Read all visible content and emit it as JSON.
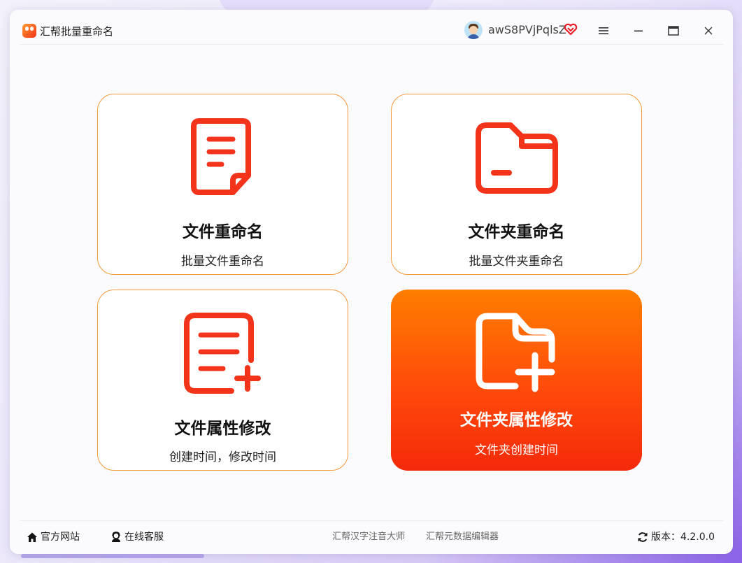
{
  "app": {
    "title": "汇帮批量重命名",
    "username": "awS8PVjPqlsZ"
  },
  "colors": {
    "accent": "#ff5a0a",
    "icon_red": "#f3331a",
    "card_border": "#f39a3a"
  },
  "cards": [
    {
      "title": "文件重命名",
      "subtitle": "批量文件重命名",
      "icon": "document-icon"
    },
    {
      "title": "文件夹重命名",
      "subtitle": "批量文件夹重命名",
      "icon": "folder-icon"
    },
    {
      "title": "文件属性修改",
      "subtitle": "创建时间，修改时间",
      "icon": "document-add-icon"
    },
    {
      "title": "文件夹属性修改",
      "subtitle": "文件夹创建时间",
      "icon": "folder-add-icon",
      "selected": true
    }
  ],
  "footer": {
    "website": "官方网站",
    "support": "在线客服",
    "links": [
      "汇帮汉字注音大师",
      "汇帮元数据编辑器"
    ],
    "version_label": "版本：4.2.0.0"
  }
}
